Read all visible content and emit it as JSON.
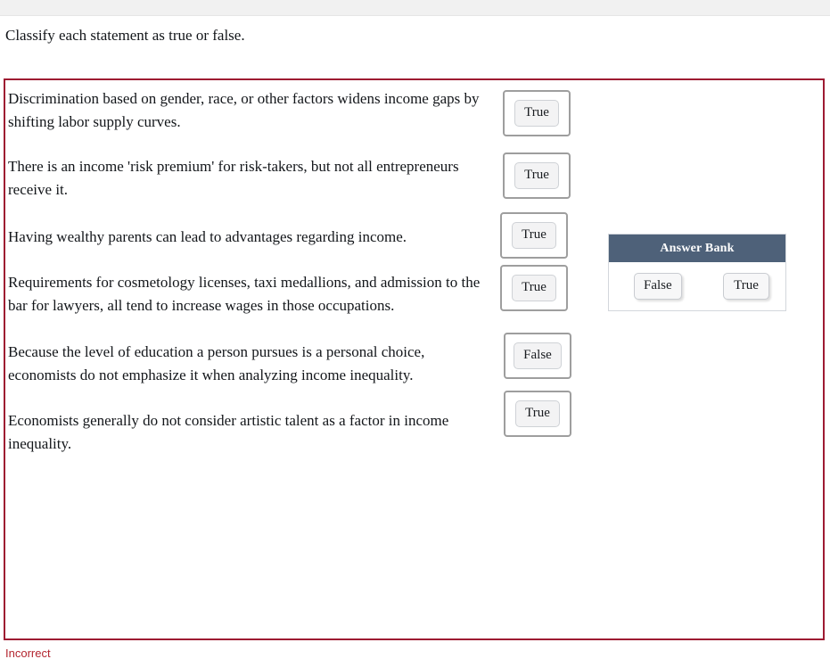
{
  "prompt": "Classify each statement as true or false.",
  "statements": [
    {
      "text": "Discrimination based on gender, race, or other factors widens income gaps by shifting labor supply curves.",
      "answer": "True"
    },
    {
      "text": "There is an income 'risk premium' for risk-takers, but not all entrepreneurs receive it.",
      "answer": "True"
    },
    {
      "text": "Having wealthy parents can lead to advantages regarding income.",
      "answer": "True"
    },
    {
      "text": "Requirements for cosmetology licenses, taxi medallions, and admission to the bar for lawyers, all tend to increase wages in those occupations.",
      "answer": "True"
    },
    {
      "text": "Because the level of education a person pursues is a personal choice, economists do not emphasize it when analyzing income inequality.",
      "answer": "False"
    },
    {
      "text": "Economists generally do not consider artistic talent as a factor in income inequality.",
      "answer": "True"
    }
  ],
  "answer_bank": {
    "title": "Answer Bank",
    "options": [
      "False",
      "True"
    ]
  },
  "feedback": {
    "text": "Incorrect"
  },
  "colors": {
    "question_border": "#9e1b32",
    "answer_bank_header": "#4e6179",
    "feedback_text": "#b3252f",
    "dropzone_border": "#9e9e9e",
    "top_strip": "#f1f1f1"
  }
}
